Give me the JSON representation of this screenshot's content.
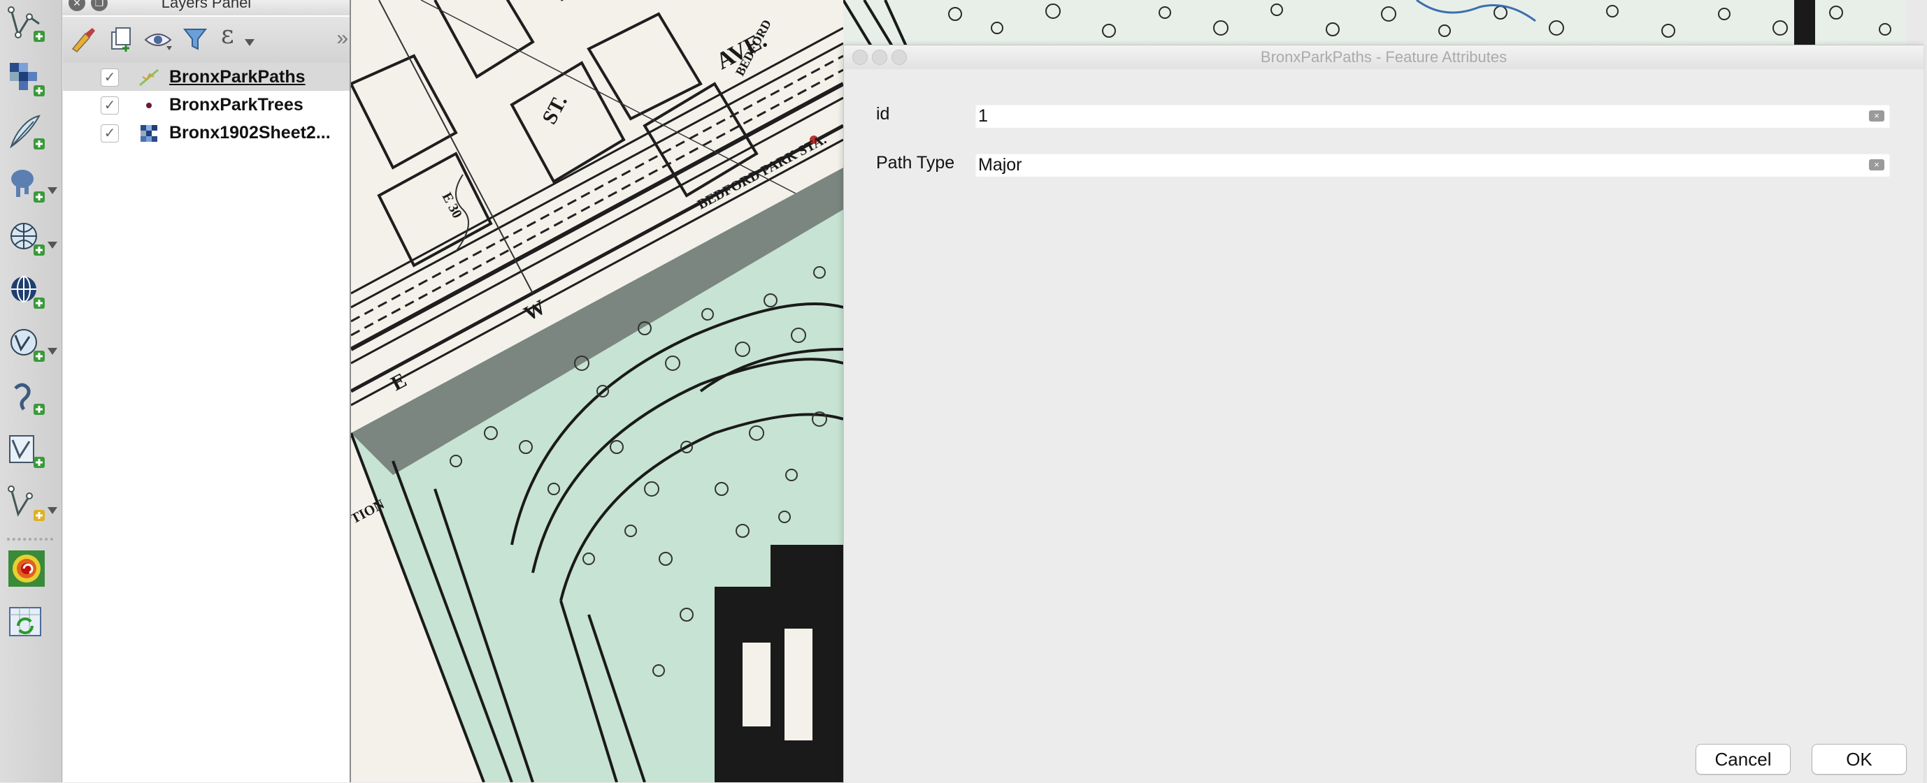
{
  "layers_panel": {
    "title": "Layers Panel",
    "layers": [
      {
        "name": "BronxParkPaths",
        "checked": true,
        "icon": "line-layer-icon",
        "selected": true
      },
      {
        "name": "BronxParkTrees",
        "checked": true,
        "icon": "point-layer-icon",
        "selected": false
      },
      {
        "name": "Bronx1902Sheet2...",
        "checked": true,
        "icon": "raster-layer-icon",
        "selected": false
      }
    ],
    "toolbar_icons": [
      "style-manager-icon",
      "add-group-icon",
      "manage-visibility-icon",
      "filter-legend-icon",
      "filter-expression-icon"
    ],
    "more_symbol": "»",
    "expression_symbol": "ε"
  },
  "side_toolbar": {
    "icons": [
      "new-vector-layer-icon",
      "add-raster-layer-icon",
      "add-delimited-text-icon",
      "add-postgis-layer-icon",
      "add-wms-layer-icon",
      "add-wfs-layer-icon",
      "add-wcs-layer-icon",
      "add-spatialite-layer-icon",
      "new-shapefile-icon",
      "new-virtual-layer-icon",
      "heatmap-icon",
      "refresh-table-icon"
    ]
  },
  "map": {
    "street_labels": [
      "AVE.",
      "ST.",
      "W",
      "E",
      "BEDFORD PARK STA.",
      "BEDFORD",
      "TION",
      "E 30"
    ]
  },
  "dialog": {
    "title": "BronxParkPaths - Feature Attributes",
    "fields": [
      {
        "label": "id",
        "value": "1"
      },
      {
        "label": "Path Type",
        "value": "Major"
      }
    ],
    "cancel_label": "Cancel",
    "ok_label": "OK"
  },
  "colors": {
    "map_paper": "#f3f1ea",
    "park_green": "#bfe0cf",
    "selection_gray": "#d9d9d9"
  }
}
